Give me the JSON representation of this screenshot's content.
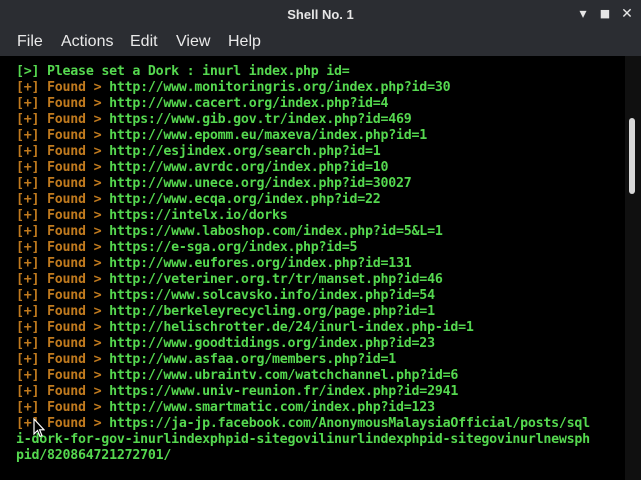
{
  "window": {
    "title": "Shell No. 1"
  },
  "menu": [
    "File",
    "Actions",
    "Edit",
    "View",
    "Help"
  ],
  "controls": {
    "minimize": "▾",
    "maximize": "■",
    "close": "✕"
  },
  "prompt": {
    "bracket": "[>]",
    "text": " Please set a Dork : inurl index.php id="
  },
  "results": [
    {
      "marker": "[+]",
      "label": " Found > ",
      "url": "http://www.monitoringris.org/index.php?id=30"
    },
    {
      "marker": "[+]",
      "label": " Found > ",
      "url": "http://www.cacert.org/index.php?id=4"
    },
    {
      "marker": "[+]",
      "label": " Found > ",
      "url": "https://www.gib.gov.tr/index.php?id=469"
    },
    {
      "marker": "[+]",
      "label": " Found > ",
      "url": "http://www.epomm.eu/maxeva/index.php?id=1"
    },
    {
      "marker": "[+]",
      "label": " Found > ",
      "url": "http://esjindex.org/search.php?id=1"
    },
    {
      "marker": "[+]",
      "label": " Found > ",
      "url": "http://www.avrdc.org/index.php?id=10"
    },
    {
      "marker": "[+]",
      "label": " Found > ",
      "url": "http://www.unece.org/index.php?id=30027"
    },
    {
      "marker": "[+]",
      "label": " Found > ",
      "url": "http://www.ecqa.org/index.php?id=22"
    },
    {
      "marker": "[+]",
      "label": " Found > ",
      "url": "https://intelx.io/dorks"
    },
    {
      "marker": "[+]",
      "label": " Found > ",
      "url": "https://www.laboshop.com/index.php?id=5&L=1"
    },
    {
      "marker": "[+]",
      "label": " Found > ",
      "url": "https://e-sga.org/index.php?id=5"
    },
    {
      "marker": "[+]",
      "label": " Found > ",
      "url": "http://www.eufores.org/index.php?id=131"
    },
    {
      "marker": "[+]",
      "label": " Found > ",
      "url": "http://veteriner.org.tr/tr/manset.php?id=46"
    },
    {
      "marker": "[+]",
      "label": " Found > ",
      "url": "https://www.solcavsko.info/index.php?id=54"
    },
    {
      "marker": "[+]",
      "label": " Found > ",
      "url": "http://berkeleyrecycling.org/page.php?id=1"
    },
    {
      "marker": "[+]",
      "label": " Found > ",
      "url": "http://helischrotter.de/24/inurl-index.php-id=1"
    },
    {
      "marker": "[+]",
      "label": " Found > ",
      "url": "http://www.goodtidings.org/index.php?id=23"
    },
    {
      "marker": "[+]",
      "label": " Found > ",
      "url": "http://www.asfaa.org/members.php?id=1"
    },
    {
      "marker": "[+]",
      "label": " Found > ",
      "url": "http://www.ubraintv.com/watchchannel.php?id=6"
    },
    {
      "marker": "[+]",
      "label": " Found > ",
      "url": "https://www.univ-reunion.fr/index.php?id=2941"
    },
    {
      "marker": "[+]",
      "label": " Found > ",
      "url": "http://www.smartmatic.com/index.php?id=123"
    },
    {
      "marker": "[+]",
      "label": " Found > ",
      "url": "https://ja-jp.facebook.com/AnonymousMalaysiaOfficial/posts/sql"
    }
  ],
  "wrapped": [
    "i-dork-for-gov-inurlindexphpid-sitegovilinurlindexphpid-sitegovinurlnewsph",
    "pid/820864721272701/"
  ],
  "colors": {
    "green": "#55d84f",
    "orange": "#c07a1e",
    "background": "#000000",
    "chrome": "#2b2d32"
  }
}
